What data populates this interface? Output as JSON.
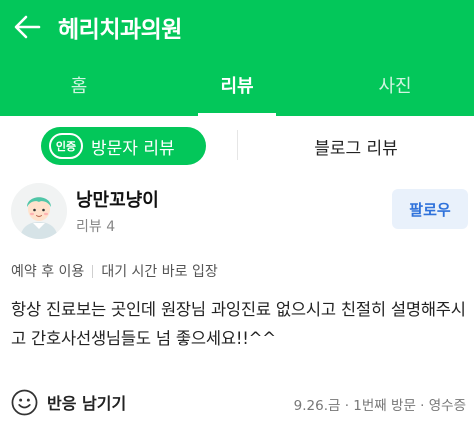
{
  "header": {
    "title": "헤리치과의원",
    "tabs": [
      {
        "label": "홈"
      },
      {
        "label": "리뷰"
      },
      {
        "label": "사진"
      }
    ],
    "bg_color": "#03c75a",
    "icons": {
      "back": "back-arrow-icon"
    }
  },
  "subtabs": {
    "visitor_badge": "인증",
    "visitor_label": "방문자 리뷰",
    "blog_label": "블로그 리뷰"
  },
  "review": {
    "author": "낭만꼬냥이",
    "review_count": "리뷰 4",
    "follow_label": "팔로우",
    "tags": [
      "예약 후 이용",
      "대기 시간 바로 입장"
    ],
    "text": "항상 진료보는 곳인데 원장님 과잉진료 없으시고 친절히 설명해주시고 간호사선생님들도 넘 좋으세요!!^^",
    "react_label": "반응 남기기",
    "visit_info": "9.26.금 · 1번째 방문 · 영수증",
    "icons": {
      "avatar": "avatar-icon",
      "react": "smile-icon"
    }
  }
}
